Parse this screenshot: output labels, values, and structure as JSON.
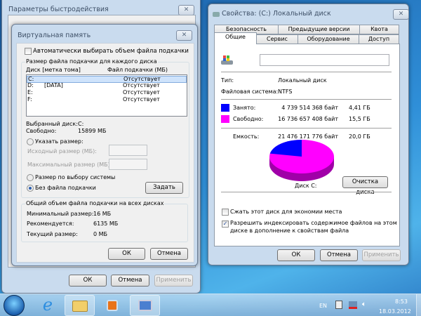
{
  "performance_window": {
    "title": "Параметры быстродействия",
    "ok": "ОК",
    "cancel": "Отмена",
    "apply": "Применить"
  },
  "virtual_memory": {
    "title": "Виртуальная память",
    "auto_manage": {
      "label": "Автоматически выбирать объем файла подкачки",
      "checked": false
    },
    "group_per_disk": "Размер файла подкачки для каждого диска",
    "col_disk": "Диск [метка тома]",
    "col_pagefile": "Файл подкачки (МБ)",
    "drives": [
      {
        "drive": "C:",
        "label": "",
        "pagefile": "Отсутствует",
        "selected": true
      },
      {
        "drive": "D:",
        "label": "[DATA]",
        "pagefile": "Отсутствует"
      },
      {
        "drive": "E:",
        "label": "",
        "pagefile": "Отсутствует"
      },
      {
        "drive": "F:",
        "label": "",
        "pagefile": "Отсутствует"
      }
    ],
    "selected_disk_label": "Выбранный диск:",
    "selected_disk": "C:",
    "free_label": "Свободно:",
    "free": "15899 МБ",
    "custom_size": "Указать размер:",
    "initial_size": "Исходный размер (МБ):",
    "max_size": "Максимальный размер (МБ):",
    "initial_value": "",
    "max_value": "",
    "system_managed": "Размер по выбору системы",
    "no_pagefile": "Без файла подкачки",
    "set": "Задать",
    "total_group": "Общий объем файла подкачки на всех дисках",
    "min_label": "Минимальный размер:",
    "min": "16 МБ",
    "rec_label": "Рекомендуется:",
    "rec": "6135 МБ",
    "cur_label": "Текущий размер:",
    "cur": "0 МБ",
    "ok": "ОК",
    "cancel": "Отмена"
  },
  "properties": {
    "title": "Свойства: (C:) Локальный диск",
    "tabs_row1": [
      "Безопасность",
      "Предыдущие версии",
      "Квота"
    ],
    "tabs_row2": [
      "Общие",
      "Сервис",
      "Оборудование",
      "Доступ"
    ],
    "volume_name": "",
    "type_label": "Тип:",
    "type": "Локальный диск",
    "fs_label": "Файловая система:",
    "fs": "NTFS",
    "used_label": "Занято:",
    "used_bytes": "4 739 514 368 байт",
    "used_gb": "4,41 ГБ",
    "free_label": "Свободно:",
    "free_bytes": "16 736 657 408 байт",
    "free_gb": "15,5 ГБ",
    "cap_label": "Емкость:",
    "cap_bytes": "21 476 171 776 байт",
    "cap_gb": "20,0 ГБ",
    "used_fraction": 0.2207,
    "used_color": "#0000ff",
    "free_color": "#ff00ff",
    "disk_label": "Диск C:",
    "cleanup": "Очистка диска",
    "compress": {
      "label": "Сжать этот диск для экономии места",
      "checked": false
    },
    "index": {
      "line1": "Разрешить индексировать содержимое файлов на этом",
      "line2": "диске в дополнение к свойствам файла",
      "checked": true
    },
    "ok": "ОК",
    "cancel": "Отмена",
    "apply": "Применить"
  },
  "taskbar": {
    "lang": "EN",
    "time": "8:53",
    "date": "18.03.2012",
    "items": [
      "start-orb",
      "internet-explorer",
      "windows-explorer",
      "media-player",
      "system-properties"
    ]
  }
}
